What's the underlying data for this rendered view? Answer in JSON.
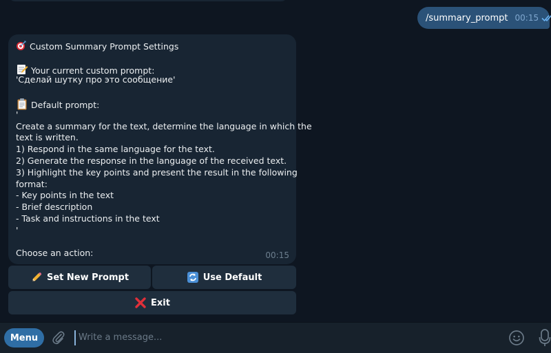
{
  "outgoing": {
    "text": "/summary_prompt",
    "time": "00:15"
  },
  "message": {
    "lines": [
      {
        "emoji": "dart-icon",
        "text": "Custom Summary Prompt Settings"
      },
      {
        "emoji": null,
        "text": ""
      },
      {
        "emoji": "memo-icon",
        "text": "Your current custom prompt:"
      },
      {
        "emoji": null,
        "text": "'Сделай шутку про это сообщение'"
      },
      {
        "emoji": null,
        "text": ""
      },
      {
        "emoji": "clipboard-icon",
        "text": "Default prompt:"
      },
      {
        "emoji": null,
        "text": "'"
      },
      {
        "emoji": null,
        "text": "Create a summary for the text, determine the language in which the"
      },
      {
        "emoji": null,
        "text": "text is written."
      },
      {
        "emoji": null,
        "text": "1) Respond in the same language for the text."
      },
      {
        "emoji": null,
        "text": "2) Generate the response in the language of the received text."
      },
      {
        "emoji": null,
        "text": "3) Highlight the key points and present the result in the following"
      },
      {
        "emoji": null,
        "text": "format:"
      },
      {
        "emoji": null,
        "text": "- Key points in the text"
      },
      {
        "emoji": null,
        "text": "- Brief description"
      },
      {
        "emoji": null,
        "text": "- Task and instructions in the text"
      },
      {
        "emoji": null,
        "text": "'"
      },
      {
        "emoji": null,
        "text": ""
      },
      {
        "emoji": null,
        "text": "Choose an action:"
      }
    ],
    "time": "00:15"
  },
  "keyboard": {
    "set_new_prompt": "Set New Prompt",
    "use_default": "Use Default",
    "exit": "Exit"
  },
  "composer": {
    "menu_label": "Menu",
    "placeholder": "Write a message..."
  }
}
